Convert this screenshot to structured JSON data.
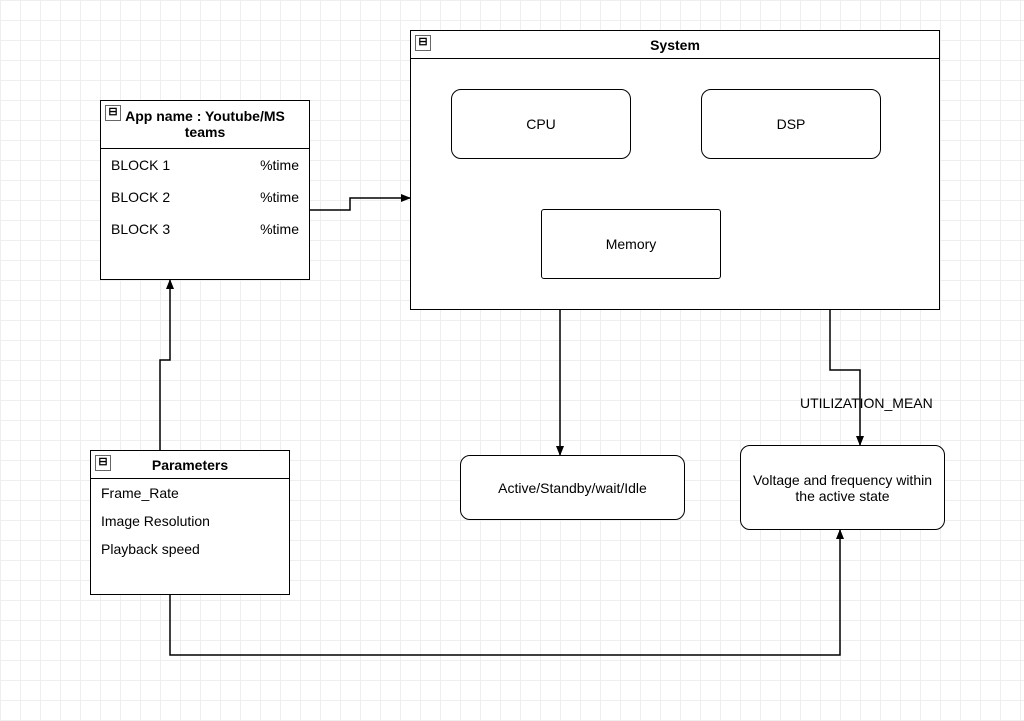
{
  "app_block": {
    "title": "App name : Youtube/MS teams",
    "rows": [
      {
        "label": "BLOCK 1",
        "value": "%time"
      },
      {
        "label": "BLOCK 2",
        "value": "%time"
      },
      {
        "label": "BLOCK 3",
        "value": "%time"
      }
    ]
  },
  "system_block": {
    "title": "System",
    "children": {
      "cpu": "CPU",
      "dsp": "DSP",
      "memory": "Memory"
    }
  },
  "parameters_block": {
    "title": "Parameters",
    "items": [
      "Frame_Rate",
      "Image Resolution",
      "Playback speed"
    ]
  },
  "state_block": {
    "text": "Active/Standby/wait/Idle"
  },
  "voltage_block": {
    "text": "Voltage and frequency within the active state"
  },
  "edge_labels": {
    "utilization": "UTILIZATION_MEAN"
  },
  "icons": {
    "collapse": "⊟"
  }
}
